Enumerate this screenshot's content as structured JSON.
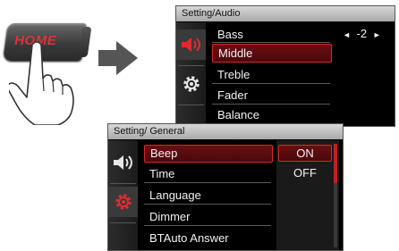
{
  "illustration": {
    "home_label": "HOME"
  },
  "audio": {
    "title": "Setting/Audio",
    "items": [
      "Bass",
      "Middle",
      "Treble",
      "Fader",
      "Balance"
    ],
    "value": "-2",
    "left_arrow": "◄",
    "right_arrow": "►"
  },
  "general": {
    "title": "Setting/ General",
    "items": [
      "Beep",
      "Time",
      "Language",
      "Dimmer",
      "BTAuto Answer"
    ],
    "options": [
      "ON",
      "OFF"
    ]
  },
  "colors": {
    "accent": "#d8262e",
    "selected_bg": "#5a0b0f",
    "panel_bg": "#000000"
  }
}
